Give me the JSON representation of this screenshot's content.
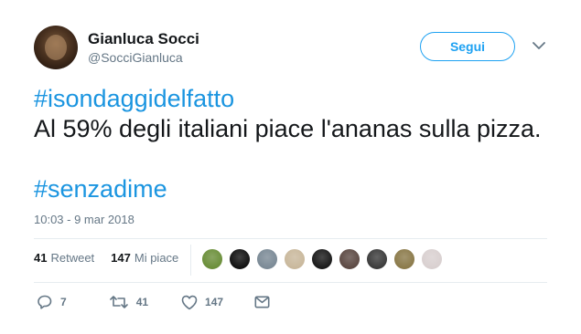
{
  "user": {
    "name": "Gianluca Socci",
    "handle": "@SocciGianluca"
  },
  "follow_label": "Segui",
  "tweet": {
    "hashtag1": "#isondaggidelfatto",
    "text": "Al 59% degli italiani piace l'ananas sulla pizza.",
    "hashtag2": "#senzadime"
  },
  "timestamp": "10:03 - 9 mar 2018",
  "stats": {
    "retweet_count": "41",
    "retweet_label": "Retweet",
    "like_count": "147",
    "like_label": "Mi piace"
  },
  "likers": [
    {
      "icon": "flower-avatar",
      "color": "#6b8f3a"
    },
    {
      "icon": "logo-avatar",
      "color": "#111111"
    },
    {
      "icon": "cat-avatar",
      "color": "#7b8a96"
    },
    {
      "icon": "dog-avatar",
      "color": "#c9b89c"
    },
    {
      "icon": "dark-avatar",
      "color": "#1a1a1a"
    },
    {
      "icon": "woman-avatar",
      "color": "#5d4a44"
    },
    {
      "icon": "man-avatar",
      "color": "#3c3c3c"
    },
    {
      "icon": "face-avatar",
      "color": "#8b7a4a"
    },
    {
      "icon": "octopus-avatar",
      "color": "#d9d0d0"
    }
  ],
  "actions": {
    "reply_count": "7",
    "retweet_count": "41",
    "like_count": "147"
  },
  "colors": {
    "accent": "#1da1f2",
    "hashtag": "#1b95e0",
    "secondary_text": "#657786"
  }
}
